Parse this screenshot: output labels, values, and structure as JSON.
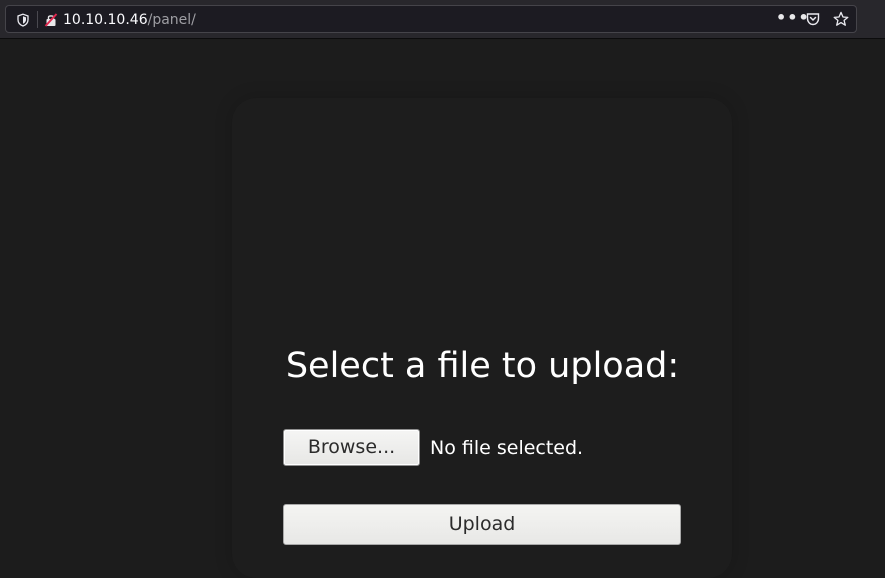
{
  "browser": {
    "url_host": "10.10.10.46",
    "url_path": "/panel/",
    "icons": {
      "tracking": "shield-icon",
      "insecure": "insecure-lock-icon",
      "page_actions": "more-options-icon",
      "pocket": "pocket-icon",
      "bookmark": "bookmark-star-icon"
    }
  },
  "page": {
    "heading": "Select a file to upload:",
    "browse_label": "Browse...",
    "file_status": "No file selected.",
    "upload_label": "Upload"
  },
  "colors": {
    "background": "#1c1c1c",
    "text": "#ffffff",
    "button": "#f2f2f0"
  }
}
